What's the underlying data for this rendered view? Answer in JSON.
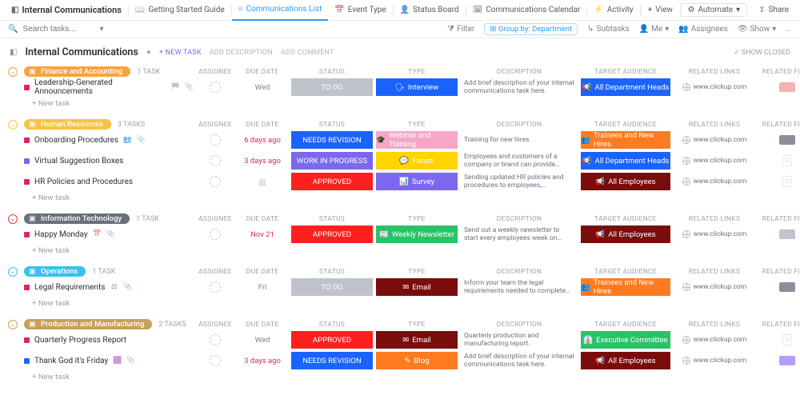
{
  "app": {
    "title": "Internal Communications",
    "tabs": [
      {
        "icon": "📖",
        "label": "Getting Started Guide"
      },
      {
        "icon": "≡",
        "label": "Communications List",
        "active": true
      },
      {
        "icon": "📅",
        "label": "Event Type"
      },
      {
        "icon": "👤",
        "label": "Status Board"
      },
      {
        "icon": "🗓",
        "label": "Communications Calendar"
      },
      {
        "icon": "⚡",
        "label": "Activity"
      }
    ],
    "add_view": "View",
    "automate": "Automate",
    "share": "Share"
  },
  "toolbar": {
    "search_placeholder": "Search tasks...",
    "filter": "Filter",
    "group": "Group by: Department",
    "subtasks": "Subtasks",
    "me": "Me",
    "assignees": "Assignees",
    "show": "Show"
  },
  "header": {
    "title": "Internal Communications",
    "new_task": "+ NEW TASK",
    "add_desc": "ADD DESCRIPTION",
    "add_comment": "ADD COMMENT",
    "show_closed": "SHOW CLOSED"
  },
  "columns": {
    "assignee": "ASSIGNEE",
    "due": "DUE DATE",
    "status": "STATUS",
    "type": "TYPE",
    "desc": "DESCRIPTION",
    "audience": "TARGET AUDIENCE",
    "links": "RELATED LINKS",
    "files": "RELATED FILES"
  },
  "link_text": "www.clickup.com",
  "newtask": "+ New task",
  "task_suffix_single": "TASK",
  "task_suffix_plural": "TASKS",
  "groups": [
    {
      "name": "Finance and Accounting",
      "color": "#f9a33f",
      "chev": "c1",
      "count": 1,
      "tasks": [
        {
          "sq": "#e0245e",
          "name": "Leadership-Generated Announcements",
          "icons": [
            "🏁",
            "📎"
          ],
          "due": "Wed",
          "overdue": false,
          "status": {
            "text": "TO DO",
            "bg": "#bfc3c9"
          },
          "type": {
            "text": "Interview",
            "icon": "🗣",
            "bg": "#1a63ff"
          },
          "desc": "Add brief description of your internal communications task here.",
          "audience": {
            "text": "All Department Heads",
            "icon": "📢",
            "bg": "#1a63ff"
          },
          "link": true,
          "file": {
            "kind": "badge",
            "bg": "#f6b1b1"
          }
        }
      ]
    },
    {
      "name": "Human Resources",
      "color": "#f5c443",
      "chev": "c2",
      "count": 3,
      "tasks": [
        {
          "sq": "#e0245e",
          "name": "Onboarding Procedures",
          "icons": [
            "👥",
            "📎"
          ],
          "due": "6 days ago",
          "overdue": true,
          "status": {
            "text": "NEEDS REVISION",
            "bg": "#1a63ff"
          },
          "type": {
            "text": "Webinar and Training",
            "icon": "🎓",
            "bg": "#f7a6c7"
          },
          "desc": "Training for new hires.",
          "audience": {
            "text": "Trainees and New Hires",
            "icon": "👥",
            "bg": "#ff7b1f"
          },
          "link": true,
          "file": {
            "kind": "badge",
            "bg": "#8a8f98"
          }
        },
        {
          "sq": "#7b68ee",
          "name": "Virtual Suggestion Boxes",
          "icons": [],
          "due": "3 days ago",
          "overdue": true,
          "status": {
            "text": "WORK IN PROGRESS",
            "bg": "#7b68ee"
          },
          "type": {
            "text": "Forum",
            "icon": "💬",
            "bg": "#ffd400"
          },
          "desc": "Employees and customers of a company or brand can provide feedback or comments ...",
          "audience": {
            "text": "All Department Heads",
            "icon": "📢",
            "bg": "#1a63ff"
          },
          "link": true,
          "file": {
            "kind": "doc"
          }
        },
        {
          "sq": "#e0245e",
          "name": "HR Policies and Procedures",
          "icons": [],
          "due": "",
          "overdue": false,
          "due_placeholder": true,
          "status": {
            "text": "APPROVED",
            "bg": "#ff1f1f"
          },
          "type": {
            "text": "Survey",
            "icon": "📊",
            "bg": "#7b68ee"
          },
          "desc": "Sending updated HR policies and procedures to employees, supervisors, and anyone with re-...",
          "audience": {
            "text": "All Employees",
            "icon": "📢",
            "bg": "#7a0c0c"
          },
          "link": true,
          "file": {
            "kind": "doc"
          }
        }
      ]
    },
    {
      "name": "Information Technology",
      "color": "#6a707a",
      "chev": "c3",
      "count": 1,
      "tasks": [
        {
          "sq": "#e0245e",
          "name": "Happy Monday",
          "icons": [
            "📅",
            "📎"
          ],
          "due": "Nov 21",
          "overdue": true,
          "status": {
            "text": "APPROVED",
            "bg": "#ff1f1f"
          },
          "type": {
            "text": "Weekly Newsletter",
            "icon": "📰",
            "bg": "#28c366"
          },
          "desc": "Send out a weekly newsletter to start every employees week on track.",
          "audience": {
            "text": "All Employees",
            "icon": "📢",
            "bg": "#7a0c0c"
          },
          "link": true,
          "file": {
            "kind": "badge",
            "bg": "#c0c4cb"
          }
        }
      ]
    },
    {
      "name": "Operations",
      "color": "#39c0f0",
      "chev": "c4",
      "count": 1,
      "tasks": [
        {
          "sq": "#e0245e",
          "name": "Legal Requirements",
          "icons": [
            "⚖",
            "📎"
          ],
          "due": "Fri",
          "overdue": false,
          "status": {
            "text": "TO DO",
            "bg": "#bfc3c9"
          },
          "type": {
            "text": "Email",
            "icon": "✉",
            "bg": "#7a0c0c"
          },
          "desc": "Inform your team the legal requirements needed to complete the proposed project.",
          "audience": {
            "text": "Trainees and New Hires",
            "icon": "👥",
            "bg": "#ff7b1f"
          },
          "link": true,
          "file": {
            "kind": "badge",
            "bg": "#8a8f98"
          }
        }
      ]
    },
    {
      "name": "Production and Manufacturing",
      "color": "#c8a05a",
      "chev": "c5",
      "count": 2,
      "tasks": [
        {
          "sq": "#e0245e",
          "name": "Quarterly Progress Report",
          "icons": [],
          "due": "Wed",
          "overdue": false,
          "status": {
            "text": "APPROVED",
            "bg": "#ff1f1f"
          },
          "type": {
            "text": "Email",
            "icon": "✉",
            "bg": "#7a0c0c"
          },
          "desc": "Quarterly production and manufacturing report.",
          "audience": {
            "text": "Executive Committee",
            "icon": "👔",
            "bg": "#28c366"
          },
          "link": true,
          "file": {
            "kind": "doc"
          }
        },
        {
          "sq": "#1a63ff",
          "name": "Thank God it's Friday",
          "icons": [
            "🟪",
            "📎"
          ],
          "due": "3 days ago",
          "overdue": true,
          "status": {
            "text": "NEEDS REVISION",
            "bg": "#1a63ff"
          },
          "type": {
            "text": "Blog",
            "icon": "✎",
            "bg": "#ff7b1f"
          },
          "desc": "Add brief description of your internal communications task here.",
          "audience": {
            "text": "All Employees",
            "icon": "📢",
            "bg": "#7a0c0c"
          },
          "link": true,
          "file": {
            "kind": "badge",
            "bg": "#b79cff"
          }
        }
      ]
    }
  ]
}
